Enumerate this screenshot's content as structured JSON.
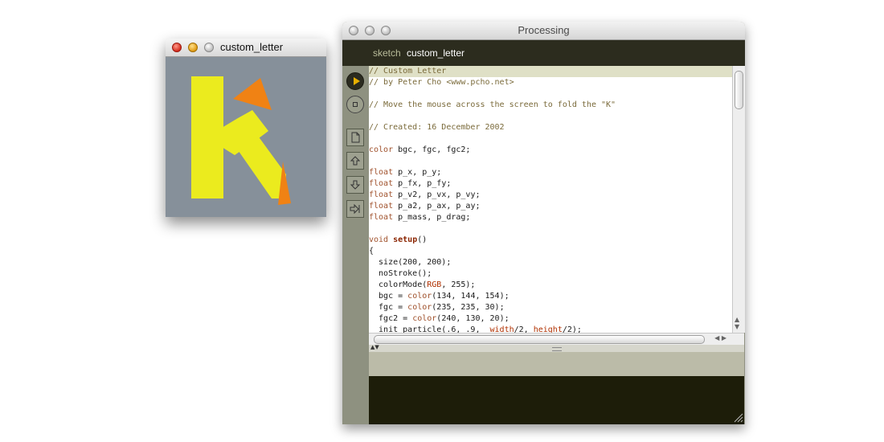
{
  "sketch_window": {
    "title": "custom_letter",
    "colors": {
      "background": "#86909a",
      "letter": "#ebeb1e",
      "fold": "#f08214"
    }
  },
  "editor_window": {
    "title": "Processing",
    "tab": {
      "label": "sketch",
      "name": "custom_letter"
    },
    "toolbar_icons": [
      "run-icon",
      "stop-icon",
      "new-icon",
      "open-icon",
      "save-icon",
      "export-icon"
    ],
    "code_lines": [
      "// Custom Letter",
      "// by Peter Cho <www.pcho.net>",
      "",
      "// Move the mouse across the screen to fold the \"K\"",
      "",
      "// Created: 16 December 2002",
      "",
      "color bgc, fgc, fgc2;",
      "",
      "float p_x, p_y;",
      "float p_fx, p_fy;",
      "float p_v2, p_vx, p_vy;",
      "float p_a2, p_ax, p_ay;",
      "float p_mass, p_drag;",
      "",
      "void setup()",
      "{",
      "  size(200, 200);",
      "  noStroke();",
      "  colorMode(RGB, 255);",
      "  bgc = color(134, 144, 154);",
      "  fgc = color(235, 235, 30);",
      "  fgc2 = color(240, 130, 20);",
      "  init_particle(.6, .9,  width/2, height/2);"
    ],
    "highlighted_line": 0,
    "colors": {
      "header": "#2c2c1e",
      "console": "#1d1d09",
      "status": "#bbbba8",
      "toolbar": "#8e9180"
    }
  }
}
